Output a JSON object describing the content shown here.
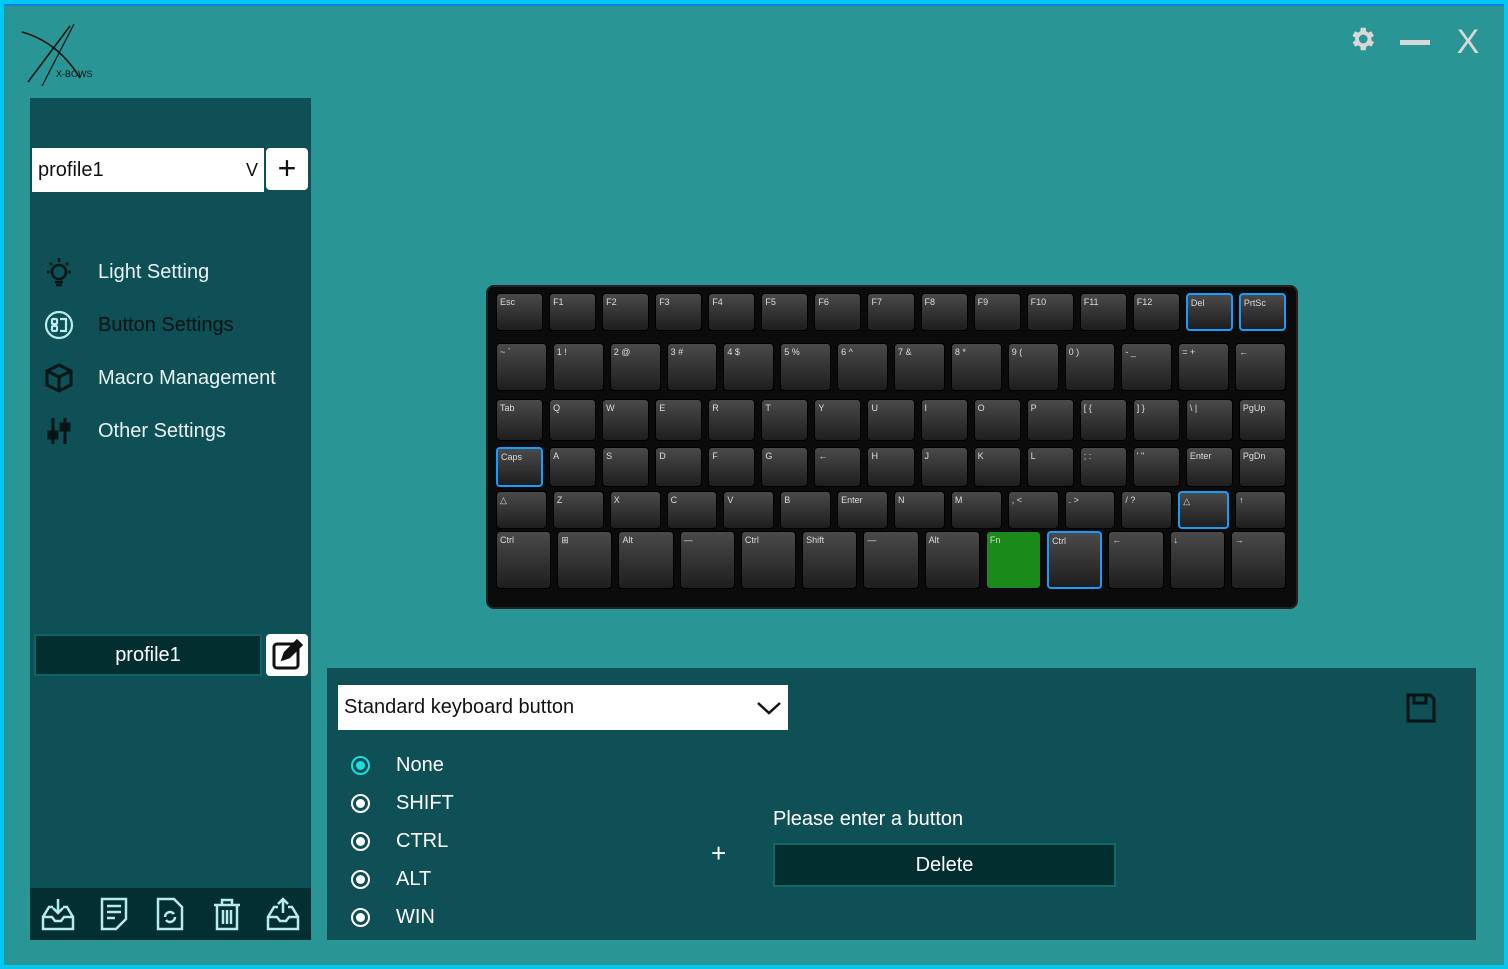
{
  "app": {
    "logo_text": "X-BOWS"
  },
  "titlebar": {
    "settings_icon": "gear-icon",
    "minimize_icon": "minus-icon",
    "close_label": "X"
  },
  "sidebar": {
    "profile_selected": "profile1",
    "dropdown_glyph": "V",
    "add_label": "+",
    "items": [
      {
        "label": "Light Setting",
        "icon": "lightbulb-icon",
        "active": false
      },
      {
        "label": "Button Settings",
        "icon": "keyboard-circle-icon",
        "active": true
      },
      {
        "label": "Macro Management",
        "icon": "cube-icon",
        "active": false
      },
      {
        "label": "Other Settings",
        "icon": "sliders-icon",
        "active": false
      }
    ],
    "current_profile": "profile1",
    "bottom_icons": [
      "import-icon",
      "notes-icon",
      "reset-file-icon",
      "trash-icon",
      "export-icon"
    ]
  },
  "keyboard": {
    "rows": [
      [
        {
          "l": "Esc"
        },
        {
          "l": "F1"
        },
        {
          "l": "F2"
        },
        {
          "l": "F3"
        },
        {
          "l": "F4"
        },
        {
          "l": "F5"
        },
        {
          "l": "F6"
        },
        {
          "l": "F7"
        },
        {
          "l": "F8"
        },
        {
          "l": "F9"
        },
        {
          "l": "F10"
        },
        {
          "l": "F11"
        },
        {
          "l": "F12"
        },
        {
          "l": "Del",
          "hl": true
        },
        {
          "l": "PrtSc",
          "hl": true
        }
      ],
      [
        {
          "l": "~ `"
        },
        {
          "l": "1 !"
        },
        {
          "l": "2 @"
        },
        {
          "l": "3 #"
        },
        {
          "l": "4 $"
        },
        {
          "l": "5 %"
        },
        {
          "l": "6 ^"
        },
        {
          "l": "7 &"
        },
        {
          "l": "8 *"
        },
        {
          "l": "9 ("
        },
        {
          "l": "0 )"
        },
        {
          "l": "- _"
        },
        {
          "l": "= +"
        },
        {
          "l": "←"
        }
      ],
      [
        {
          "l": "Tab"
        },
        {
          "l": "Q"
        },
        {
          "l": "W"
        },
        {
          "l": "E"
        },
        {
          "l": "R"
        },
        {
          "l": "T"
        },
        {
          "l": "Y"
        },
        {
          "l": "U"
        },
        {
          "l": "I"
        },
        {
          "l": "O"
        },
        {
          "l": "P"
        },
        {
          "l": "[ {"
        },
        {
          "l": "] }"
        },
        {
          "l": "\\ |"
        },
        {
          "l": "PgUp"
        }
      ],
      [
        {
          "l": "Caps",
          "hl": true
        },
        {
          "l": "A"
        },
        {
          "l": "S"
        },
        {
          "l": "D"
        },
        {
          "l": "F"
        },
        {
          "l": "G"
        },
        {
          "l": "←"
        },
        {
          "l": "H"
        },
        {
          "l": "J"
        },
        {
          "l": "K"
        },
        {
          "l": "L"
        },
        {
          "l": "; :"
        },
        {
          "l": "' \""
        },
        {
          "l": "Enter"
        },
        {
          "l": "PgDn"
        }
      ],
      [
        {
          "l": "△"
        },
        {
          "l": "Z"
        },
        {
          "l": "X"
        },
        {
          "l": "C"
        },
        {
          "l": "V"
        },
        {
          "l": "B"
        },
        {
          "l": "Enter"
        },
        {
          "l": "N"
        },
        {
          "l": "M"
        },
        {
          "l": ", <"
        },
        {
          "l": ". >"
        },
        {
          "l": "/ ?"
        },
        {
          "l": "△",
          "hl": true
        },
        {
          "l": "↑"
        }
      ],
      [
        {
          "l": "Ctrl"
        },
        {
          "l": "⊞"
        },
        {
          "l": "Alt"
        },
        {
          "l": "—"
        },
        {
          "l": "Ctrl"
        },
        {
          "l": "Shift"
        },
        {
          "l": "—"
        },
        {
          "l": "Alt"
        },
        {
          "l": "Fn",
          "fn": true
        },
        {
          "l": "Ctrl",
          "hl": true
        },
        {
          "l": "←"
        },
        {
          "l": "↓"
        },
        {
          "l": "→"
        }
      ]
    ],
    "highlight_color": "#1a9cff",
    "fn_color": "#1a8a1a"
  },
  "panel": {
    "key_type": "Standard keyboard button",
    "modifiers": [
      {
        "label": "None",
        "selected": true
      },
      {
        "label": "SHIFT",
        "selected": false
      },
      {
        "label": "CTRL",
        "selected": false
      },
      {
        "label": "ALT",
        "selected": false
      },
      {
        "label": "WIN",
        "selected": false
      }
    ],
    "plus": "+",
    "prompt": "Please enter a button",
    "delete_label": "Delete",
    "save_icon": "floppy-disk-icon"
  },
  "colors": {
    "background": "#2a9595",
    "sidebar": "#0f4f56",
    "accent": "#19e0e0",
    "border": "#00c8f0"
  }
}
